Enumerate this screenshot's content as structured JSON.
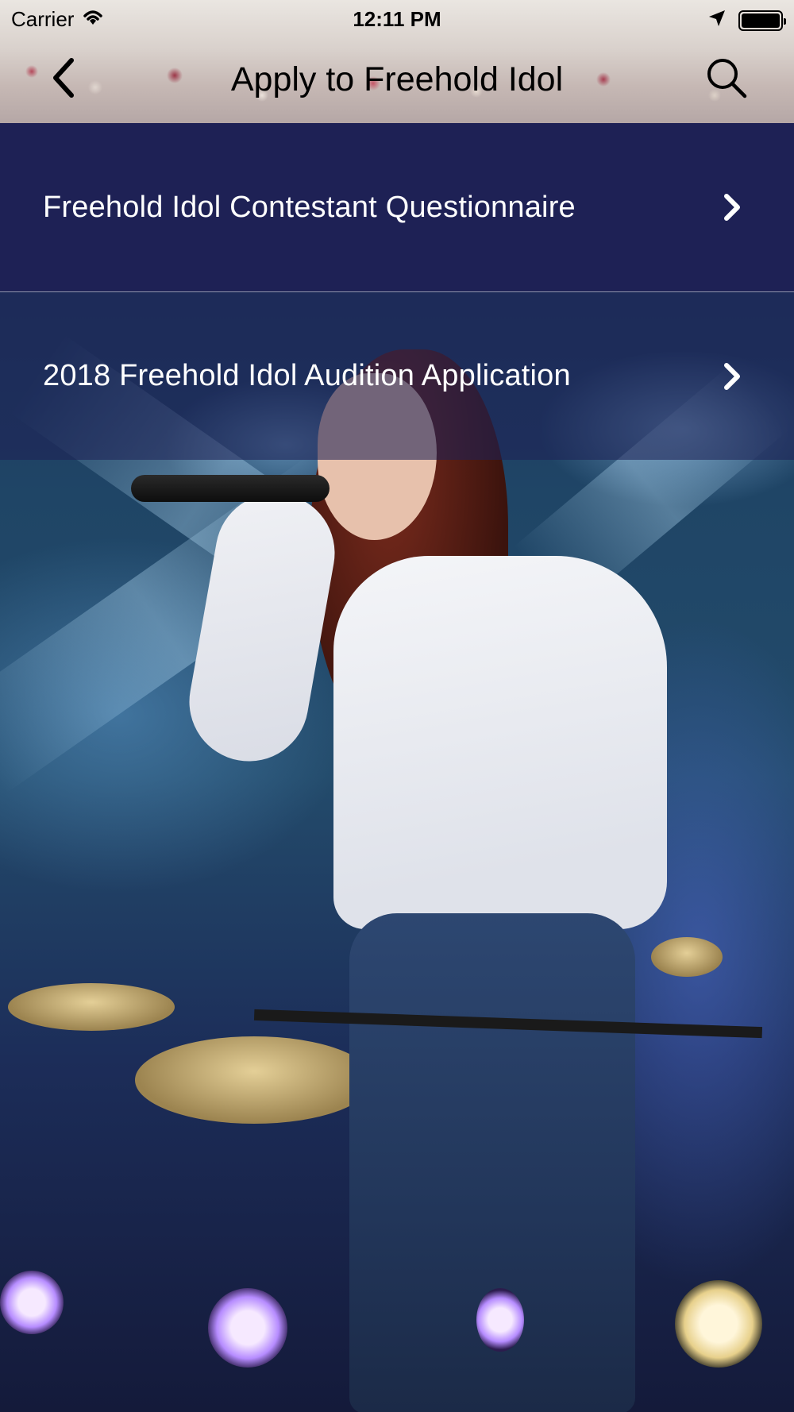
{
  "status_bar": {
    "carrier": "Carrier",
    "time": "12:11 PM",
    "battery_level": 1.0,
    "icons": [
      "wifi-icon",
      "location-arrow-icon",
      "battery-icon"
    ]
  },
  "nav": {
    "title": "Apply to Freehold Idol",
    "back_icon": "chevron-left-icon",
    "search_icon": "search-icon"
  },
  "list": {
    "items": [
      {
        "label": "Freehold Idol Contestant Questionnaire",
        "icon": "chevron-right-icon"
      },
      {
        "label": "2018 Freehold Idol Audition Application",
        "icon": "chevron-right-icon"
      }
    ]
  },
  "colors": {
    "row_primary": "#1e2155",
    "row_secondary_overlay": "rgba(30,33,85,0.58)",
    "text_on_rows": "#ffffff"
  }
}
